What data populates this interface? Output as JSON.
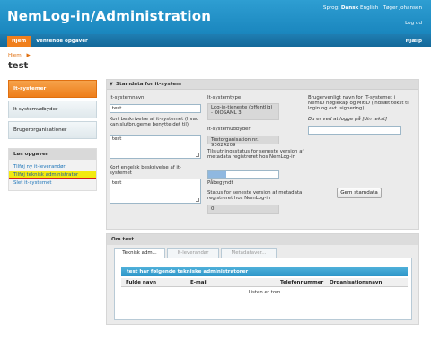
{
  "app": {
    "title": "NemLog-in/Administration"
  },
  "topbar": {
    "language_label": "Sprog:",
    "lang_da": "Dansk",
    "lang_en": "English",
    "user": "Tøger Johansen",
    "logout": "Log ud"
  },
  "nav": {
    "home": "Hjem",
    "pending": "Ventende opgaver",
    "help": "Hjælp"
  },
  "breadcrumb": {
    "home": "Hjem",
    "arrow": "▶"
  },
  "page": {
    "title": "test"
  },
  "sidebar": {
    "items": [
      {
        "label": "It-systemer"
      },
      {
        "label": "It-systemudbyder"
      },
      {
        "label": "Brugerorganisationer"
      }
    ]
  },
  "tasks": {
    "title": "Løs opgaver",
    "links": [
      {
        "label": "Tilføj ny it-leverandør"
      },
      {
        "label": "Tilføj teknisk administrator"
      },
      {
        "label": "Slet it-systemet"
      }
    ]
  },
  "panel": {
    "title": "Stamdata for it-system",
    "triangle": "▼"
  },
  "form": {
    "name_label": "It-systemnavn",
    "name_value": "test",
    "short_desc_label": "Kort beskrivelse af it-systemet (hvad kan slutbrugerne benytte det til)",
    "short_desc_value": "test",
    "eng_desc_label": "Kort engelsk beskrivelse af it-systemet",
    "eng_desc_value": "test",
    "type_label": "It-systemtype",
    "type_value": "Log-in-tjeneste (offentlig) - OIOSAML 3",
    "supplier_label": "It-systemudbyder",
    "supplier_value": "Testorganisation nr. 93624209",
    "conn_label": "Tilslutningsstatus for seneste version af metadata registreret hos NemLog-in",
    "conn_progress": 0.25,
    "conn_status": "Påbegyndt",
    "meta_label": "Status for seneste version af metadata registreret hos NemLog-in",
    "meta_value": "0",
    "friendly_label": "Brugervenligt navn for IT-systemet i NemID nøglekap og MitID (indsæt tekst til login og evt. signering)",
    "friendly_example": "Du er ved at logge på [din tekst]",
    "friendly_value": "",
    "save_button": "Gem stamdata"
  },
  "about": {
    "title": "Om test",
    "tabs": [
      {
        "label": "Teknisk adm..."
      },
      {
        "label": "It-leverandør"
      },
      {
        "label": "Metadataver..."
      }
    ],
    "table_title": "test har følgende tekniske administratorer",
    "columns": [
      "Fulde navn",
      "E-mail",
      "Telefonnummer",
      "Organisationsnavn"
    ],
    "empty": "Listen er tom"
  },
  "colors": {
    "accent_blue": "#1a86be",
    "accent_orange": "#ee7e1a",
    "highlight_yellow": "#f2ea10",
    "highlight_red": "#d21f1f"
  }
}
